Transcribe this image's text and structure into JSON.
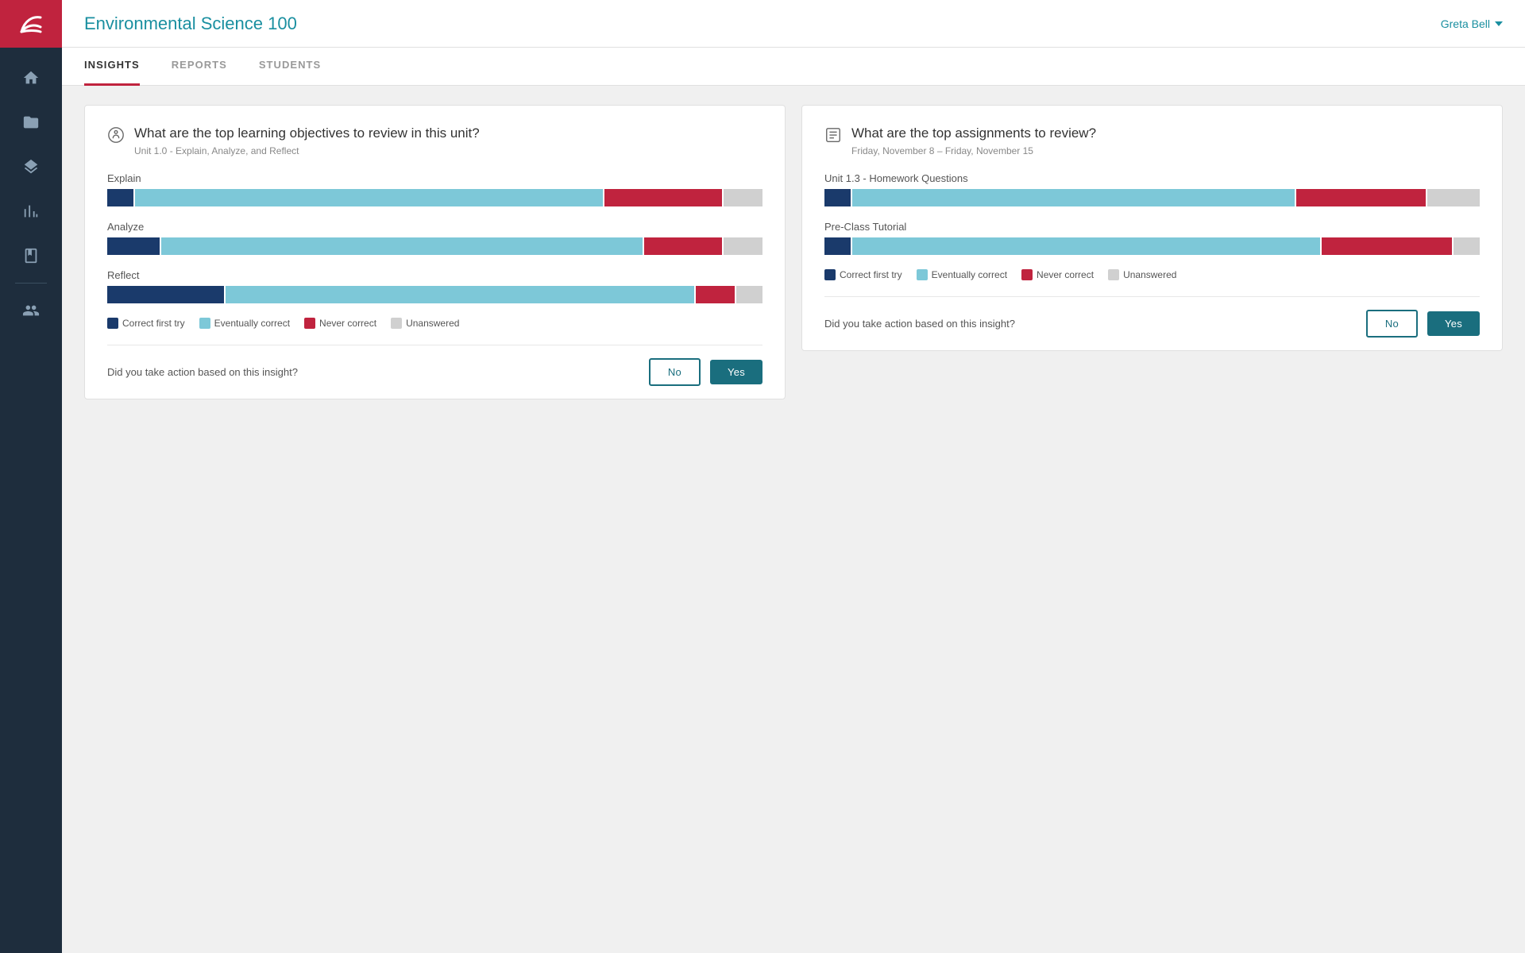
{
  "header": {
    "title": "Environmental Science 100",
    "user": "Greta Bell"
  },
  "nav": {
    "tabs": [
      {
        "id": "insights",
        "label": "INSIGHTS",
        "active": true
      },
      {
        "id": "reports",
        "label": "REPORTS",
        "active": false
      },
      {
        "id": "students",
        "label": "STUDENTS",
        "active": false
      }
    ]
  },
  "sidebar": {
    "icons": [
      "home",
      "folder",
      "layers",
      "chart-bar",
      "notebook",
      "users"
    ]
  },
  "card1": {
    "title": "What are the top learning objectives to review in this unit?",
    "subtitle": "Unit 1.0 - Explain, Analyze, and Reflect",
    "bars": [
      {
        "label": "Explain",
        "segments": [
          {
            "color": "#1a3a6b",
            "flex": 4
          },
          {
            "color": "#7dc8d8",
            "flex": 72
          },
          {
            "color": "#c0233e",
            "flex": 18
          },
          {
            "color": "#d0d0d0",
            "flex": 6
          }
        ]
      },
      {
        "label": "Analyze",
        "segments": [
          {
            "color": "#1a3a6b",
            "flex": 8
          },
          {
            "color": "#7dc8d8",
            "flex": 74
          },
          {
            "color": "#c0233e",
            "flex": 12
          },
          {
            "color": "#d0d0d0",
            "flex": 6
          }
        ]
      },
      {
        "label": "Reflect",
        "segments": [
          {
            "color": "#1a3a6b",
            "flex": 18
          },
          {
            "color": "#7dc8d8",
            "flex": 72
          },
          {
            "color": "#c0233e",
            "flex": 6
          },
          {
            "color": "#d0d0d0",
            "flex": 4
          }
        ]
      }
    ],
    "legend": [
      {
        "label": "Correct first try",
        "color": "#1a3a6b"
      },
      {
        "label": "Eventually correct",
        "color": "#7dc8d8"
      },
      {
        "label": "Never correct",
        "color": "#c0233e"
      },
      {
        "label": "Unanswered",
        "color": "#d0d0d0"
      }
    ],
    "action": {
      "question": "Did you take action based on this insight?",
      "no_label": "No",
      "yes_label": "Yes"
    }
  },
  "card2": {
    "title": "What are the top assignments to review?",
    "subtitle": "Friday, November 8 – Friday, November 15",
    "bars": [
      {
        "label": "Unit 1.3 - Homework Questions",
        "segments": [
          {
            "color": "#1a3a6b",
            "flex": 4
          },
          {
            "color": "#7dc8d8",
            "flex": 68
          },
          {
            "color": "#c0233e",
            "flex": 20
          },
          {
            "color": "#d0d0d0",
            "flex": 8
          }
        ]
      },
      {
        "label": "Pre-Class Tutorial",
        "segments": [
          {
            "color": "#1a3a6b",
            "flex": 4
          },
          {
            "color": "#7dc8d8",
            "flex": 72
          },
          {
            "color": "#c0233e",
            "flex": 20
          },
          {
            "color": "#d0d0d0",
            "flex": 4
          }
        ]
      }
    ],
    "legend": [
      {
        "label": "Correct first try",
        "color": "#1a3a6b"
      },
      {
        "label": "Eventually correct",
        "color": "#7dc8d8"
      },
      {
        "label": "Never correct",
        "color": "#c0233e"
      },
      {
        "label": "Unanswered",
        "color": "#d0d0d0"
      }
    ],
    "action": {
      "question": "Did you take action based on this insight?",
      "no_label": "No",
      "yes_label": "Yes"
    }
  }
}
